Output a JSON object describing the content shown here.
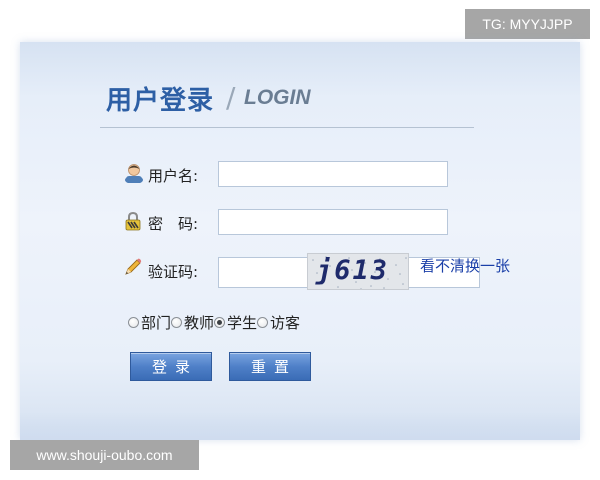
{
  "watermarks": {
    "top": "TG: MYYJJPP",
    "bottom": "www.shouji-oubo.com"
  },
  "header": {
    "title_cn": "用户登录",
    "separator": "/",
    "title_en": "LOGIN"
  },
  "form": {
    "username": {
      "label": "用户名:",
      "icon": "user-icon",
      "value": ""
    },
    "password": {
      "label": "密　码:",
      "icon": "lock-icon",
      "value": ""
    },
    "captcha": {
      "label": "验证码:",
      "icon": "pencil-icon",
      "value": "",
      "image_text": "j613",
      "refresh_label": "看不清换一张"
    },
    "roles": [
      {
        "label": "部门",
        "checked": false
      },
      {
        "label": "教师",
        "checked": false
      },
      {
        "label": "学生",
        "checked": true
      },
      {
        "label": "访客",
        "checked": false
      }
    ],
    "buttons": {
      "login_label": "登录",
      "reset_label": "重置"
    }
  },
  "colors": {
    "title": "#2d5fa5",
    "button": "#4f80c8",
    "link": "#1a3fa8"
  }
}
